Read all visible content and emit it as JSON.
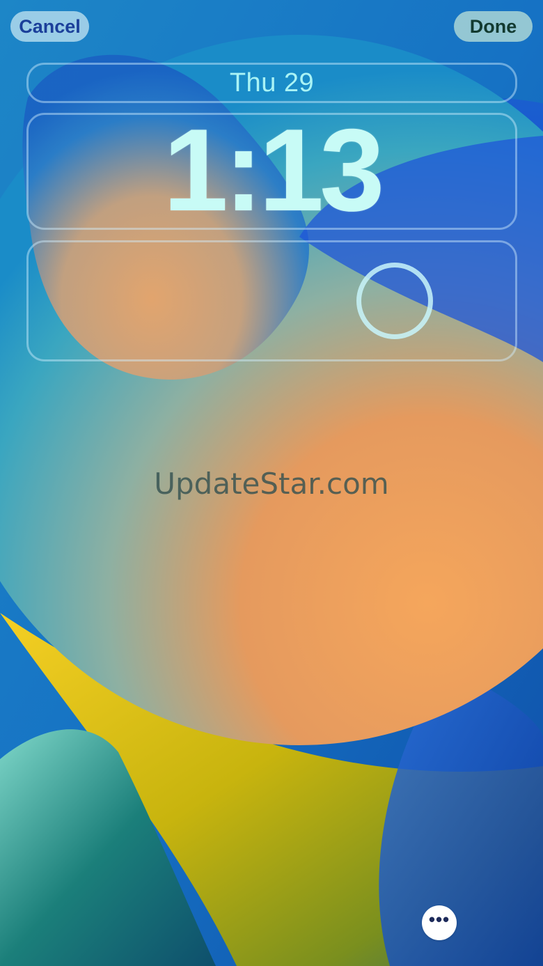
{
  "header": {
    "cancel_label": "Cancel",
    "done_label": "Done"
  },
  "lock_screen": {
    "date": "Thu 29",
    "time": "1:13",
    "widget_ring": "circle-widget-icon"
  },
  "watermark": "UpdateStar.com",
  "footer": {
    "more_icon": "ellipsis-icon",
    "more_glyph": "•••"
  },
  "colors": {
    "background_blue": "#1769c0",
    "orange": "#f0a35a",
    "yellow": "#f2c21a",
    "teal": "#2fa8b8"
  }
}
